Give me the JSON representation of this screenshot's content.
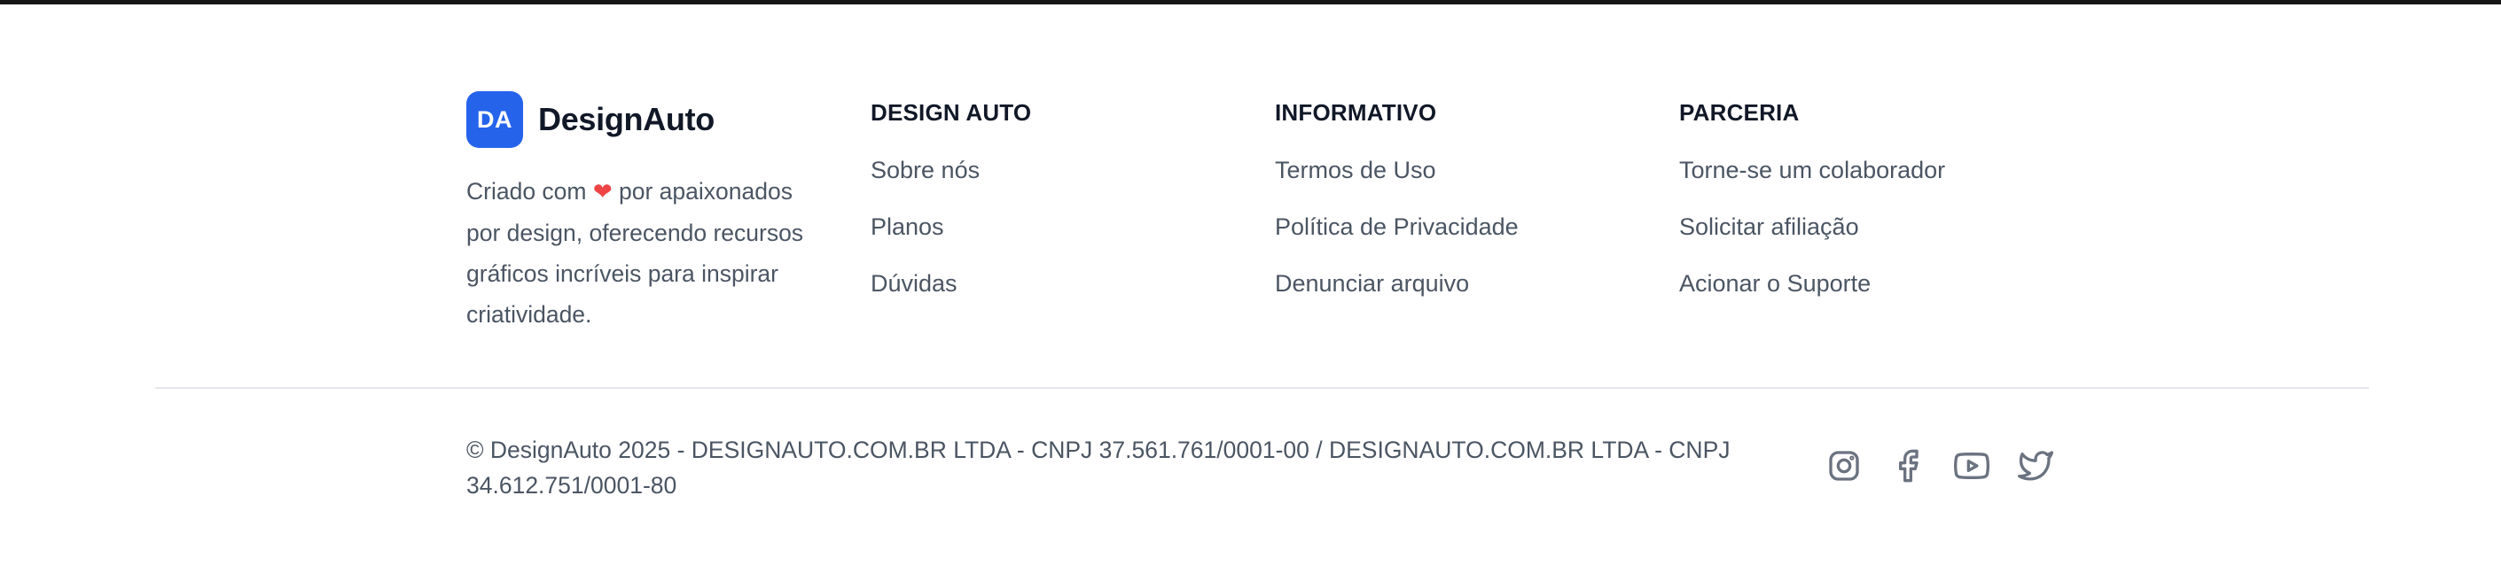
{
  "brand": {
    "badge": "DA",
    "name": "DesignAuto",
    "desc_before": "Criado com ",
    "heart": "❤",
    "desc_after": " por apaixonados por design, oferecendo recursos gráficos incríveis para inspirar criatividade."
  },
  "columns": [
    {
      "title": "DESIGN AUTO",
      "links": [
        "Sobre nós",
        "Planos",
        "Dúvidas"
      ]
    },
    {
      "title": "INFORMATIVO",
      "links": [
        "Termos de Uso",
        "Política de Privacidade",
        "Denunciar arquivo"
      ]
    },
    {
      "title": "PARCERIA",
      "links": [
        "Torne-se um colaborador",
        "Solicitar afiliação",
        "Acionar o Suporte"
      ]
    }
  ],
  "copyright": "© DesignAuto 2025 - DESIGNAUTO.COM.BR LTDA - CNPJ 37.561.761/0001-00 / DESIGNAUTO.COM.BR LTDA - CNPJ 34.612.751/0001-80",
  "socials": [
    "instagram-icon",
    "facebook-icon",
    "youtube-icon",
    "twitter-icon"
  ],
  "colors": {
    "accent": "#2563eb",
    "heart": "#ef4444",
    "heading": "#111827",
    "text": "#4b5563",
    "icon": "#6b7280",
    "divider": "#e5e7eb",
    "topbar": "#161616"
  }
}
